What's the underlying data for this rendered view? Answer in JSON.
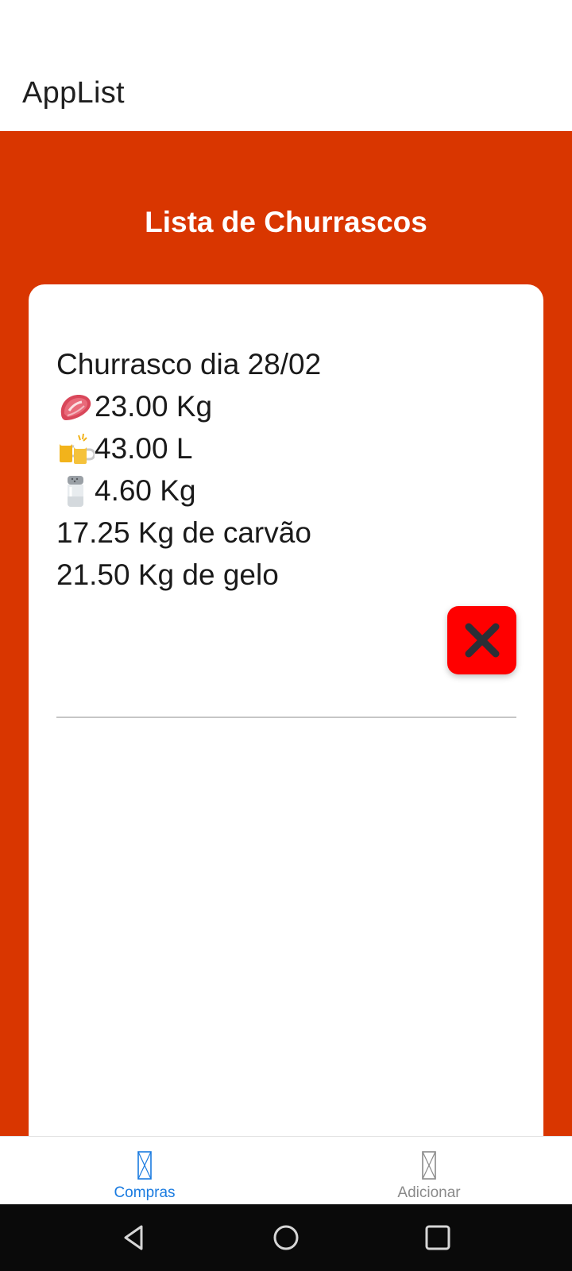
{
  "app": {
    "title": "AppList"
  },
  "main": {
    "heading": "Lista de Churrascos"
  },
  "entry": {
    "title": "Churrasco dia 28/02",
    "meat": {
      "icon": "meat-emoji-icon",
      "value": "23.00 Kg"
    },
    "beer": {
      "icon": "beer-mugs-emoji-icon",
      "value": "43.00 L"
    },
    "salt": {
      "icon": "salt-shaker-emoji-icon",
      "value": "4.60 Kg"
    },
    "charcoal": "17.25 Kg de carvão",
    "ice": "21.50 Kg de gelo",
    "delete_icon": "close-icon"
  },
  "tabs": [
    {
      "label": "Compras",
      "active": true,
      "icon": "missing-glyph-icon"
    },
    {
      "label": "Adicionar",
      "active": false,
      "icon": "missing-glyph-icon"
    }
  ],
  "colors": {
    "accent": "#d93600",
    "delete": "#ff0000",
    "tab_active": "#1a7be0",
    "tab_inactive": "#8a8a8a"
  },
  "system_nav": [
    "back-icon",
    "home-icon",
    "recents-icon"
  ]
}
